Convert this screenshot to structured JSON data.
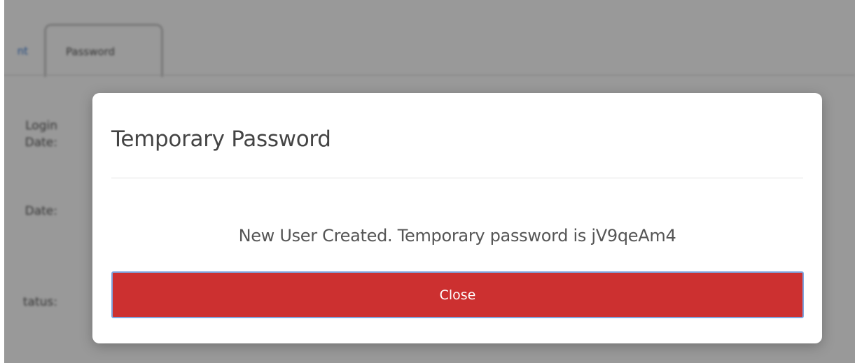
{
  "background": {
    "tab_prev_fragment": "nt",
    "tab_active_label": "Password",
    "labels": {
      "last_login_line1": "Login",
      "last_login_line2": "Date:",
      "date": "Date:",
      "status": "tatus:"
    }
  },
  "modal": {
    "title": "Temporary Password",
    "message": "New User Created. Temporary password is jV9qeAm4",
    "close_label": "Close"
  },
  "colors": {
    "close_button": "#cc3030",
    "button_focus_border": "#7fa6e0",
    "backdrop": "#999999"
  }
}
